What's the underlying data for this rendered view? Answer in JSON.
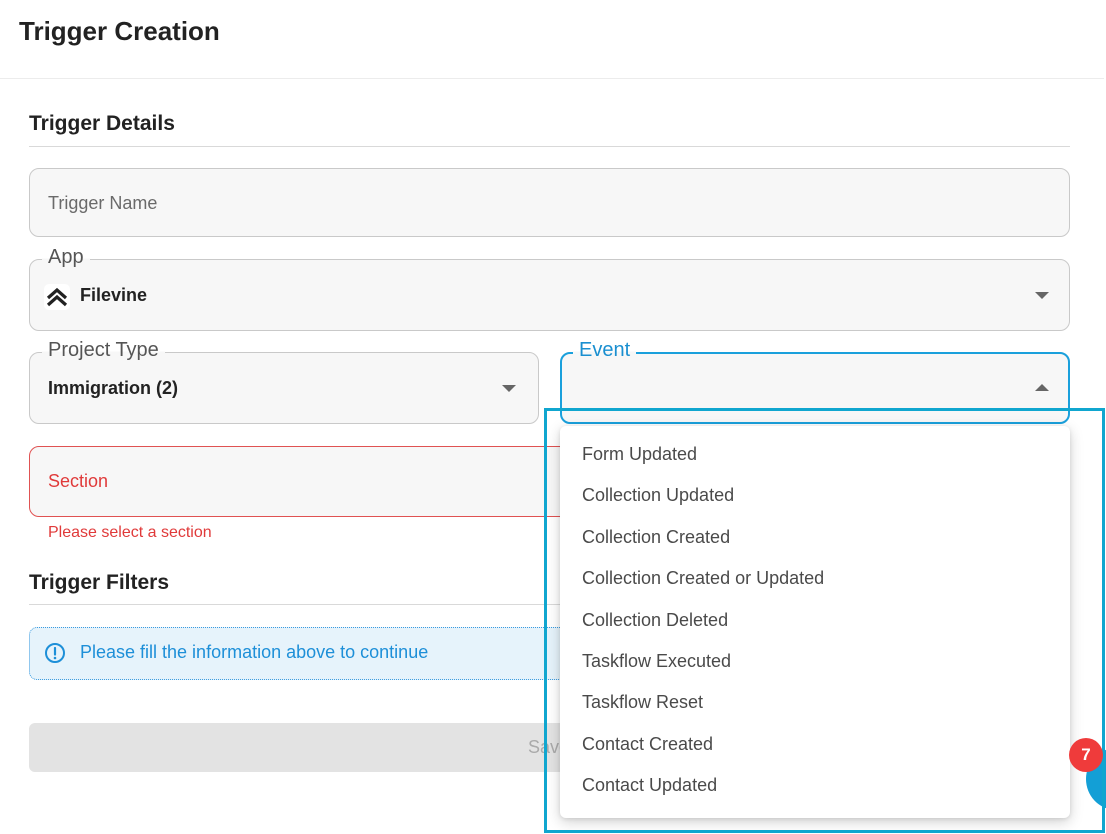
{
  "header": {
    "title": "Trigger Creation"
  },
  "trigger_details": {
    "title": "Trigger Details",
    "trigger_name": {
      "placeholder": "Trigger Name"
    },
    "app": {
      "label": "App",
      "value": "Filevine",
      "logo_icon": "filevine-logo-icon"
    },
    "project_type": {
      "label": "Project Type",
      "value": "Immigration (2)"
    },
    "event": {
      "label": "Event",
      "value": "",
      "options": [
        "Form Updated",
        "Collection Updated",
        "Collection Created",
        "Collection Created or Updated",
        "Collection Deleted",
        "Taskflow Executed",
        "Taskflow Reset",
        "Contact Created",
        "Contact Updated"
      ]
    },
    "section": {
      "placeholder": "Section",
      "error": "Please select a section"
    }
  },
  "trigger_filters": {
    "title": "Trigger Filters",
    "info": {
      "icon": "info-circle-icon",
      "text": "Please fill the information above to continue"
    }
  },
  "save_button": {
    "label": "Save"
  },
  "notification_badge": {
    "count": "7"
  },
  "colors": {
    "accent": "#1aa0dc",
    "error": "#e03a3a",
    "info_bg": "#e6f3fb",
    "highlight": "#10a6cf",
    "badge": "#ef3b3b"
  }
}
